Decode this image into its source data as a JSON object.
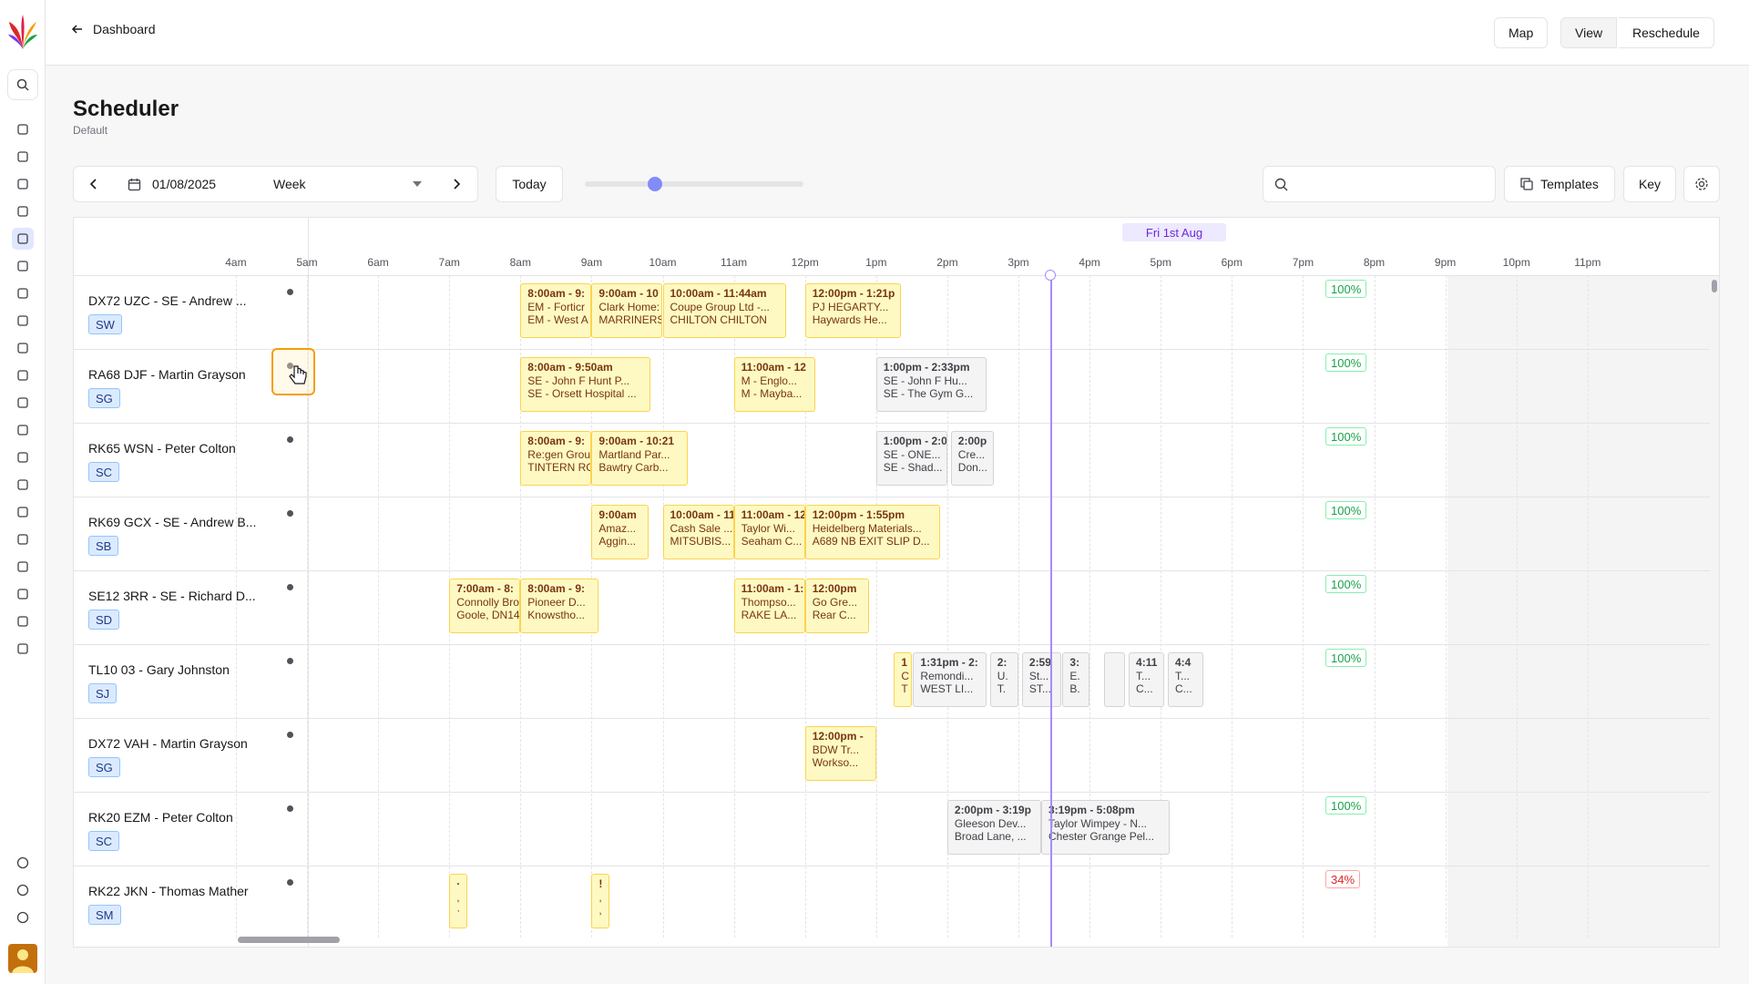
{
  "topbar": {
    "back": "Dashboard",
    "map": "Map",
    "view": "View",
    "reschedule": "Reschedule"
  },
  "page": {
    "title": "Scheduler",
    "subtitle": "Default"
  },
  "toolbar": {
    "date": "01/08/2025",
    "range": "Week",
    "today": "Today",
    "templates": "Templates",
    "key": "Key",
    "search_placeholder": ""
  },
  "day_label": "Fri 1st Aug",
  "hours": [
    "4am",
    "5am",
    "6am",
    "7am",
    "8am",
    "9am",
    "10am",
    "11am",
    "12pm",
    "1pm",
    "2pm",
    "3pm",
    "4pm",
    "5pm",
    "6pm",
    "7pm",
    "8pm",
    "9pm",
    "10pm",
    "11pm"
  ],
  "resources": [
    {
      "name": "DX72 UZC - SE - Andrew ...",
      "badge": "SW",
      "pct": "100%",
      "jobs": [
        {
          "start": 8,
          "end": 9,
          "t": "8:00am - 9:",
          "l2": "EM - Forticr",
          "l3": "EM - West A"
        },
        {
          "start": 9,
          "end": 10,
          "t": "9:00am - 10",
          "l2": "Clark Home:",
          "l3": "MARRINERS"
        },
        {
          "start": 10,
          "end": 11.73,
          "t": "10:00am - 11:44am",
          "l2": "Coupe Group Ltd -...",
          "l3": "CHILTON CHILTON"
        },
        {
          "start": 12,
          "end": 13.35,
          "t": "12:00pm - 1:21p",
          "l2": "PJ HEGARTY...",
          "l3": "Haywards He..."
        }
      ]
    },
    {
      "name": "RA68 DJF - Martin Grayson",
      "badge": "SG",
      "pct": "100%",
      "jobs": [
        {
          "start": 8,
          "end": 9.83,
          "t": "8:00am - 9:50am",
          "l2": "SE - John F Hunt P...",
          "l3": "SE - Orsett Hospital ..."
        },
        {
          "start": 11,
          "end": 12.15,
          "t": "11:00am - 12",
          "l2": "M - Englo...",
          "l3": "M - Mayba..."
        },
        {
          "start": 13,
          "end": 14.55,
          "t": "1:00pm - 2:33pm",
          "l2": "SE - John F Hu...",
          "l3": "SE - The Gym G...",
          "grey": true
        }
      ]
    },
    {
      "name": "RK65 WSN - Peter Colton",
      "badge": "SC",
      "pct": "100%",
      "jobs": [
        {
          "start": 8,
          "end": 9,
          "t": "8:00am - 9:",
          "l2": "Re:gen Grou",
          "l3": "TINTERN RC"
        },
        {
          "start": 9,
          "end": 10.35,
          "t": "9:00am - 10:21",
          "l2": "Martland Par...",
          "l3": "Bawtry Carb..."
        },
        {
          "start": 13,
          "end": 14,
          "t": "1:00pm - 2:0",
          "l2": "SE - ONE...",
          "l3": "SE - Shad...",
          "grey": true
        },
        {
          "start": 14.05,
          "end": 14.65,
          "t": "2:00p",
          "l2": "Cre...",
          "l3": "Don...",
          "grey": true
        }
      ]
    },
    {
      "name": "RK69 GCX - SE - Andrew B...",
      "badge": "SB",
      "pct": "100%",
      "jobs": [
        {
          "start": 9,
          "end": 9.8,
          "t": "9:00am",
          "l2": "Amaz...",
          "l3": "Aggin..."
        },
        {
          "start": 10,
          "end": 11,
          "t": "10:00am - 11",
          "l2": "Cash Sale ...",
          "l3": "MITSUBIS..."
        },
        {
          "start": 11,
          "end": 12,
          "t": "11:00am - 12",
          "l2": "Taylor Wi...",
          "l3": "Seaham C..."
        },
        {
          "start": 12,
          "end": 13.9,
          "t": "12:00pm - 1:55pm",
          "l2": "Heidelberg Materials...",
          "l3": "A689 NB EXIT SLIP D..."
        }
      ]
    },
    {
      "name": "SE12 3RR - SE - Richard D...",
      "badge": "SD",
      "pct": "100%",
      "jobs": [
        {
          "start": 7,
          "end": 8,
          "t": "7:00am - 8:",
          "l2": "Connolly Bro",
          "l3": "Goole, DN14"
        },
        {
          "start": 8,
          "end": 9.1,
          "t": "8:00am - 9:",
          "l2": "Pioneer D...",
          "l3": "Knowstho..."
        },
        {
          "start": 11,
          "end": 12,
          "t": "11:00am - 1:",
          "l2": "Thompso...",
          "l3": "RAKE LA..."
        },
        {
          "start": 12,
          "end": 12.9,
          "t": "12:00pm",
          "l2": "Go Gre...",
          "l3": "Rear C..."
        }
      ]
    },
    {
      "name": "TL10 03 - Gary Johnston",
      "badge": "SJ",
      "pct": "100%",
      "jobs": [
        {
          "start": 13.25,
          "end": 13.5,
          "t": "1",
          "l2": "C",
          "l3": "T"
        },
        {
          "start": 13.52,
          "end": 14.55,
          "t": "1:31pm - 2:",
          "l2": "Remondi...",
          "l3": "WEST LI...",
          "grey": true
        },
        {
          "start": 14.6,
          "end": 15,
          "t": "2:",
          "l2": "U.",
          "l3": "T.",
          "grey": true
        },
        {
          "start": 15.05,
          "end": 15.6,
          "t": "2:59",
          "l2": "St...",
          "l3": "ST...",
          "grey": true
        },
        {
          "start": 15.62,
          "end": 16,
          "t": "3:",
          "l2": "E.",
          "l3": "B.",
          "grey": true
        },
        {
          "start": 16.2,
          "end": 16.5,
          "t": "",
          "l2": "",
          "l3": "",
          "grey": true
        },
        {
          "start": 16.55,
          "end": 17.05,
          "t": "4:11",
          "l2": "T...",
          "l3": "C...",
          "grey": true
        },
        {
          "start": 17.1,
          "end": 17.6,
          "t": "4:4",
          "l2": "T...",
          "l3": "C...",
          "grey": true
        }
      ]
    },
    {
      "name": "DX72 VAH - Martin Grayson",
      "badge": "SG",
      "pct": "",
      "jobs": [
        {
          "start": 12,
          "end": 13,
          "t": "12:00pm -",
          "l2": "BDW Tr...",
          "l3": "Workso..."
        }
      ]
    },
    {
      "name": "RK20 EZM - Peter Colton",
      "badge": "SC",
      "pct": "100%",
      "jobs": [
        {
          "start": 14,
          "end": 15.32,
          "t": "2:00pm - 3:19p",
          "l2": "Gleeson Dev...",
          "l3": "Broad Lane, ...",
          "grey": true
        },
        {
          "start": 15.32,
          "end": 17.13,
          "t": "3:19pm - 5:08pm",
          "l2": "Taylor Wimpey - N...",
          "l3": "Chester Grange Pel...",
          "grey": true
        }
      ]
    },
    {
      "name": "RK22 JKN - Thomas Mather",
      "badge": "SM",
      "pct": "34%",
      "pctRed": true,
      "jobs": [
        {
          "start": 7,
          "end": 7.25,
          "t": "·",
          "l2": ",",
          "l3": "·"
        },
        {
          "start": 9,
          "end": 9.25,
          "t": "!",
          "l2": ",",
          "l3": ","
        }
      ]
    }
  ],
  "icons": [
    "plus-icon",
    "home-icon",
    "check-square-icon",
    "clipboard-icon",
    "calendar-icon",
    "calendar-plus-icon",
    "alert-triangle-icon",
    "map-icon",
    "message-icon",
    "list-check-icon",
    "network-icon",
    "database-icon",
    "clock-icon",
    "pound-icon",
    "bar-chart-icon",
    "users-icon",
    "graduation-cap-icon",
    "truck-icon",
    "book-open-icon",
    "server-icon"
  ],
  "bottom_icons": [
    "bell-icon",
    "gear-icon",
    "help-icon"
  ],
  "colors": {
    "accent": "#818cf8",
    "job_bg": "#fef9c3",
    "job_border": "#fcd34d",
    "badge_bg": "#dbeafe"
  }
}
